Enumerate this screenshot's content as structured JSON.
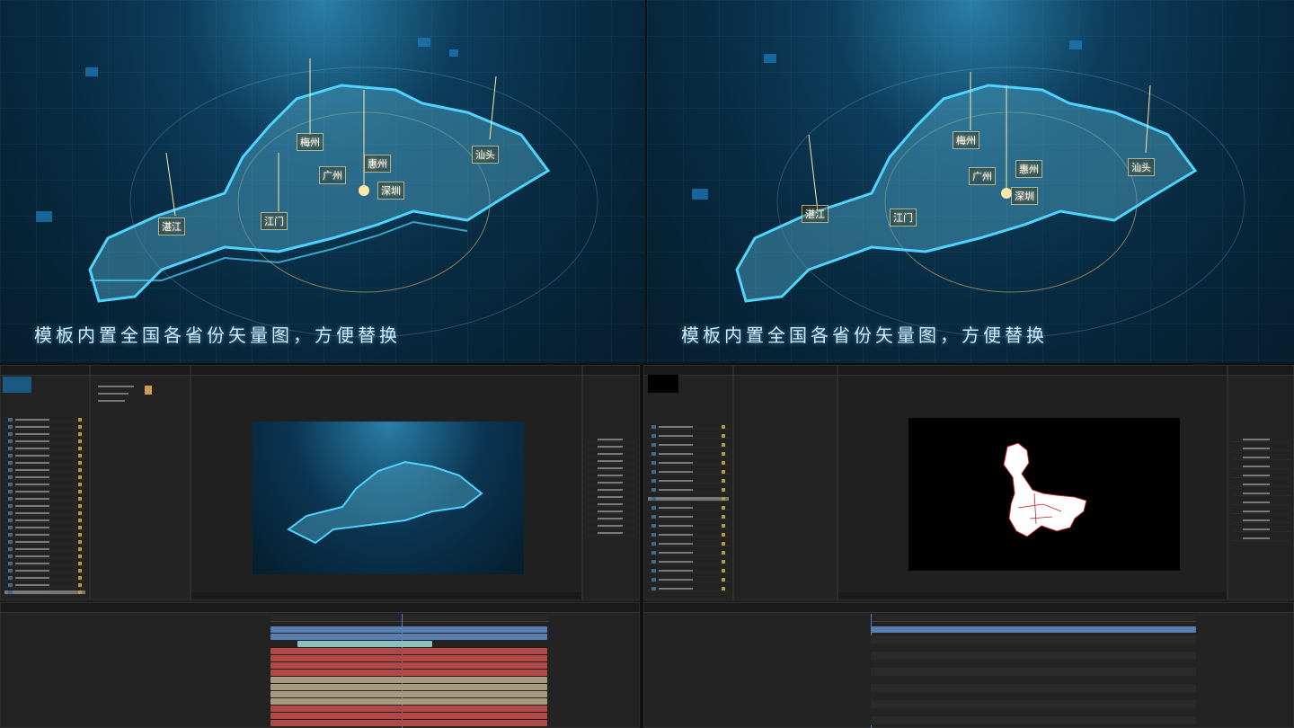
{
  "caption_left": "模板内置全国各省份矢量图，方便替换",
  "caption_right": "模板内置全国各省份矢量图，方便替换",
  "map_labels_left": [
    "梅州",
    "广州",
    "惠州",
    "汕头",
    "深圳",
    "湛江",
    "江门"
  ],
  "map_labels_right": [
    "梅州",
    "广州",
    "惠州",
    "汕头",
    "深圳",
    "湛江",
    "江门"
  ],
  "colors": {
    "glow": "#4fd3ff",
    "accent": "#ffd27a",
    "bar_red": "#b04848",
    "bar_tan": "#a89a80",
    "bar_blue": "#5a7eb0"
  }
}
